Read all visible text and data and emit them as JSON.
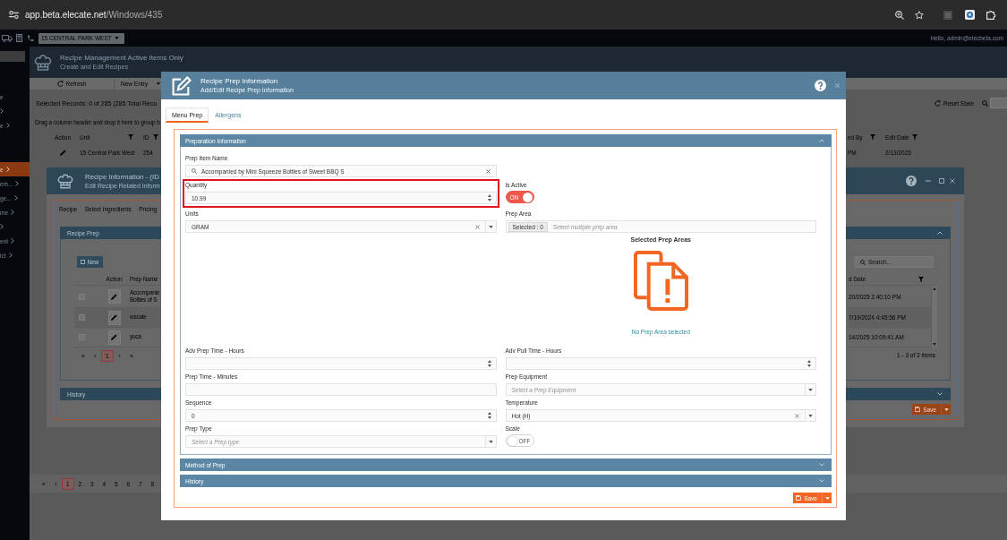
{
  "browser": {
    "host": "app.beta.elecate.net",
    "path": "/Windows/435"
  },
  "app_bar": {
    "location": "15 CENTRAL PARK WEST",
    "greeting": "Hello, admin@elecbeta.com"
  },
  "sidebar": {
    "sections": [
      {
        "items": [
          {
            "label": "e",
            "submenu": false,
            "selected": false
          },
          {
            "submenu": true,
            "selected": false
          },
          {
            "label": "e",
            "submenu": true,
            "selected": false
          }
        ]
      },
      {
        "items": [
          {
            "label": "e",
            "submenu": true,
            "selected": true
          },
          {
            "label": "em...",
            "submenu": true,
            "selected": false
          },
          {
            "label": "ge...",
            "submenu": true,
            "selected": false
          },
          {
            "label": "me",
            "submenu": true,
            "selected": false
          },
          {
            "submenu": true,
            "selected": false
          },
          {
            "label": "ent",
            "submenu": true,
            "selected": false
          },
          {
            "label": "ict",
            "submenu": true,
            "selected": false
          }
        ]
      }
    ]
  },
  "main": {
    "title": "Recipe Management Active Items Only",
    "subtitle": "Create and Edit Recipes",
    "toolbar": [
      {
        "label": "Refresh",
        "kind": "refresh"
      },
      {
        "label": "New Entry",
        "kind": "menu"
      }
    ],
    "records": "Selected Records: 0 of 285 (285 Total Reco",
    "reset_state": "Reset State",
    "group_hint": "Drag a column header and drop it here to group b",
    "columns": [
      {
        "label": "Action",
        "filterable": false
      },
      {
        "label": "Unit",
        "filterable": true
      },
      {
        "label": "ID",
        "filterable": true
      }
    ],
    "right_columns": [
      {
        "label": "ed By",
        "filterable": true
      },
      {
        "label": "Edit Date",
        "filterable": true
      }
    ],
    "row": {
      "cells": [
        "15 Central Park West",
        "254"
      ],
      "right_cells": [
        "PM",
        "2/13/2025"
      ]
    },
    "pager": [
      {
        "label": "«",
        "selected": false
      },
      {
        "label": "‹",
        "selected": false
      },
      {
        "label": "1",
        "selected": true
      },
      {
        "label": "2",
        "selected": false
      },
      {
        "label": "3",
        "selected": false
      },
      {
        "label": "4",
        "selected": false
      },
      {
        "label": "5",
        "selected": false
      },
      {
        "label": "6",
        "selected": false
      },
      {
        "label": "7",
        "selected": false
      },
      {
        "label": "8",
        "selected": false
      }
    ]
  },
  "recipe_dialog": {
    "title": "Recipe Information - (ID",
    "subtitle": "Edit Recipe Related Inform",
    "tabs": [
      {
        "label": "Recipe",
        "selected": false
      },
      {
        "label": "Select Ingredients",
        "selected": false
      },
      {
        "label": "Pricing",
        "selected": false
      }
    ],
    "panels": [
      {
        "title": "Recipe Prep",
        "expanded": true,
        "table": {
          "new_label": "New",
          "columns": [
            "Action",
            "Prep Name"
          ],
          "search_placeholder": "Search...",
          "date_column": "d Date",
          "rows": [
            {
              "checked": false,
              "name": [
                "Accompanie",
                "Bottles of S"
              ],
              "date": "20/2025 2:40:10 PM"
            },
            {
              "checked": false,
              "name": [
                "wscale"
              ],
              "date": "7/19/2024 4:45:56 PM"
            },
            {
              "checked": false,
              "name": [
                "yuca"
              ],
              "date": "14/2025 10:09:41 AM"
            }
          ],
          "pager": [
            {
              "label": "«",
              "selected": false
            },
            {
              "label": "‹",
              "selected": false
            },
            {
              "label": "1",
              "selected": true
            },
            {
              "label": "›",
              "selected": false
            },
            {
              "label": "»",
              "selected": false
            }
          ],
          "items_count": "1 - 3 of 3 items"
        }
      },
      {
        "title": "History",
        "expanded": false
      }
    ],
    "save": "Save"
  },
  "modal": {
    "title": "Recipe Prep Information",
    "subtitle": "Add/Edit Recipe Prep Information",
    "tabs": [
      {
        "label": "Menu Prep",
        "selected": true
      },
      {
        "label": "Allergens",
        "selected": false
      }
    ],
    "panels": [
      {
        "title": "Preparation Information",
        "expanded": true,
        "fields": [
          {
            "kind": "search",
            "label": "Prep Item Name",
            "value": "Accompanied by Mini Squeeze Bottles of Sweet BBQ S"
          },
          {
            "kind": "number",
            "label": "Quantity",
            "value": "10.99",
            "highlighted": true
          },
          {
            "kind": "toggle",
            "label": "Is Active",
            "on": true,
            "text": "ON"
          },
          {
            "kind": "select",
            "label": "Units",
            "value": "GRAM"
          },
          {
            "kind": "multiselect",
            "label": "Prep Area",
            "chip": "Selected : 0",
            "placeholder": "Select multiple prep area"
          },
          {
            "kind": "number",
            "label": "Adv Prep Time - Hours"
          },
          {
            "kind": "number",
            "label": "Adv Pull Time - Hours"
          },
          {
            "kind": "text",
            "label": "Prep Time - Minutes"
          },
          {
            "kind": "select",
            "label": "Prep Equipment",
            "placeholder": "Select a Prep Equipment"
          },
          {
            "kind": "number",
            "label": "Sequence",
            "value": "0"
          },
          {
            "kind": "select",
            "label": "Temperature",
            "value": "Hot (H)"
          },
          {
            "kind": "select",
            "label": "Prep Type",
            "placeholder": "Select a Prep type"
          },
          {
            "kind": "toggle",
            "label": "Scale",
            "on": false,
            "text": "OFF"
          }
        ],
        "prep_areas": {
          "title": "Selected Prep Areas",
          "empty_text": "No Prep Area selected"
        }
      },
      {
        "title": "Method of Prep",
        "expanded": false
      },
      {
        "title": "History",
        "expanded": false
      }
    ],
    "save": "Save"
  }
}
